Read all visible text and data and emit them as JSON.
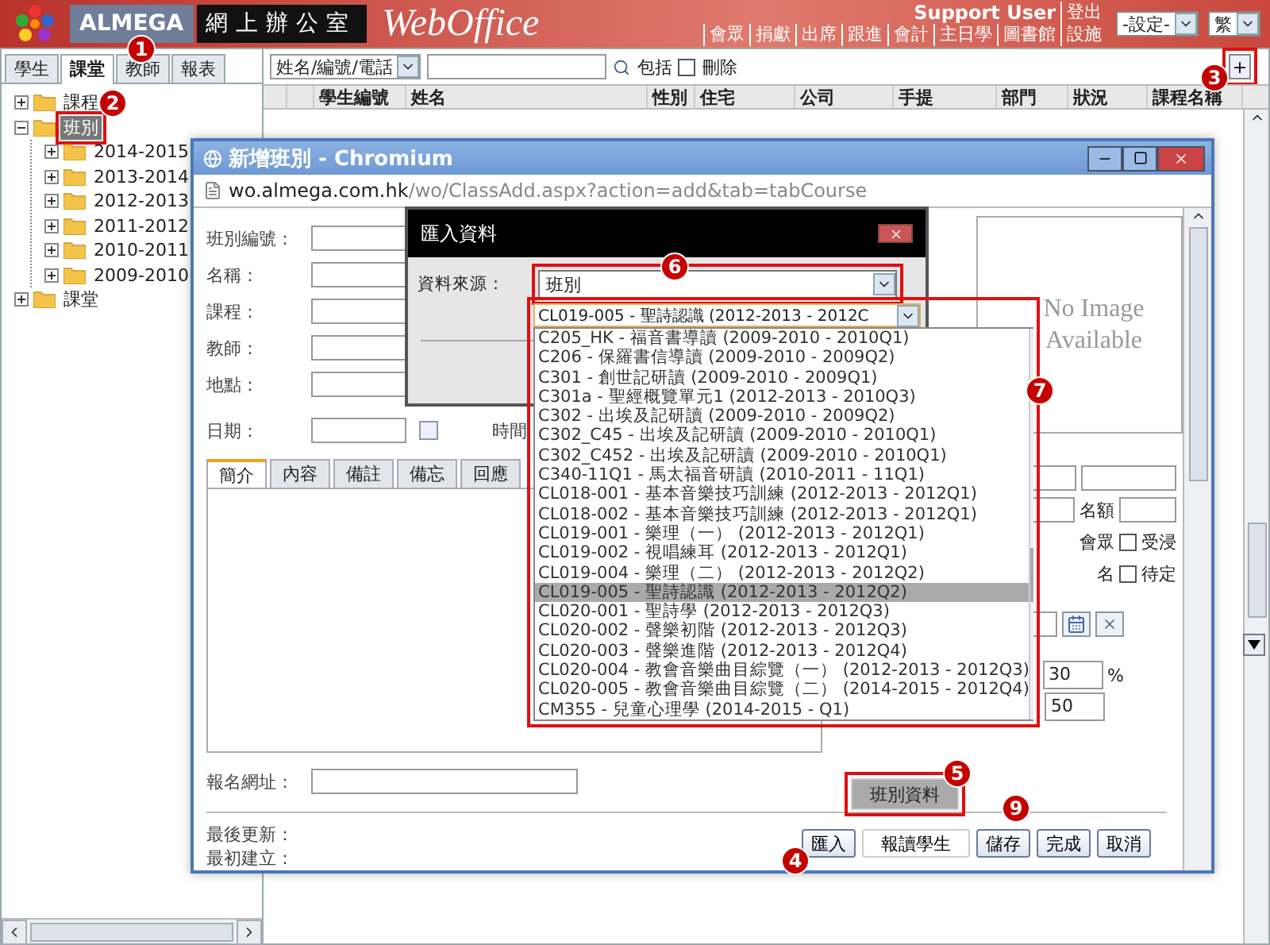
{
  "header": {
    "brand": "ALMEGA",
    "title": "網上辦公室",
    "product": "WebOffice",
    "user": "Support User",
    "logout": "登出",
    "nav": [
      "會眾",
      "捐獻",
      "出席",
      "跟進",
      "會計",
      "主日學",
      "圖書館",
      "設施"
    ],
    "settings_select": "-設定-",
    "language_select": "繁"
  },
  "left_panel": {
    "tabs": [
      {
        "label": "學生",
        "selected": false
      },
      {
        "label": "課堂",
        "selected": true
      },
      {
        "label": "教師",
        "selected": false
      },
      {
        "label": "報表",
        "selected": false
      }
    ],
    "tree": [
      {
        "label": "課程",
        "selected": false,
        "expanded": false
      },
      {
        "label": "班別",
        "selected": true,
        "expanded": true,
        "children": [
          {
            "label": "2014-2015",
            "selected": false,
            "expanded": false
          },
          {
            "label": "2013-2014",
            "selected": false,
            "expanded": false
          },
          {
            "label": "2012-2013",
            "selected": false,
            "expanded": false
          },
          {
            "label": "2011-2012",
            "selected": false,
            "expanded": false
          },
          {
            "label": "2010-2011",
            "selected": false,
            "expanded": false
          },
          {
            "label": "2009-2010",
            "selected": false,
            "expanded": false
          }
        ]
      },
      {
        "label": "課堂",
        "selected": false,
        "expanded": false
      }
    ]
  },
  "main": {
    "search_by": "姓名/編號/電話",
    "include_label": "包括",
    "delete_label": "刪除",
    "delete_checked": false,
    "add_button": "+",
    "columns": [
      "學生編號",
      "姓名",
      "性別",
      "住宅",
      "公司",
      "手提",
      "部門",
      "狀況",
      "課程名稱"
    ]
  },
  "popup": {
    "title": "新增班別 - Chromium",
    "url_host": "wo.almega.com.hk",
    "url_path": "/wo/ClassAdd.aspx?action=add&tab=tabCourse",
    "fields": [
      "班別編號：",
      "名稱：",
      "課程：",
      "教師：",
      "地點：",
      "日期："
    ],
    "time_label": "時間",
    "image_text": [
      "No Image",
      "Available"
    ],
    "quota_label": "名額",
    "checkboxes": [
      {
        "prefix": "會眾",
        "label": "受浸",
        "checked": false
      },
      {
        "prefix": "名",
        "label": "待定",
        "checked": false
      }
    ],
    "percent_value": "30",
    "percent_sign": "%",
    "second_value": "50",
    "tabs": [
      {
        "label": "簡介",
        "selected": true
      },
      {
        "label": "內容",
        "selected": false
      },
      {
        "label": "備註",
        "selected": false
      },
      {
        "label": "備忘",
        "selected": false
      },
      {
        "label": "回應",
        "selected": false
      }
    ],
    "url_label": "報名網址：",
    "meta": [
      "最後更新：",
      "最初建立："
    ],
    "buttons": [
      "匯入",
      "報讀學生",
      "儲存",
      "完成",
      "取消"
    ],
    "menu": [
      {
        "label": "班別資料",
        "selected": true
      }
    ]
  },
  "import_dialog": {
    "title": "匯入資料",
    "source_label": "資料來源：",
    "source_value": "班別"
  },
  "class_dropdown": {
    "value": "CL019-005 - 聖詩認識 (2012-2013 - 2012C",
    "options": [
      {
        "label": "C205_HK - 福音書導讀 (2009-2010 - 2010Q1)",
        "selected": false
      },
      {
        "label": "C206 - 保羅書信導讀 (2009-2010 - 2009Q2)",
        "selected": false
      },
      {
        "label": "C301 - 創世記研讀 (2009-2010 - 2009Q1)",
        "selected": false
      },
      {
        "label": "C301a - 聖經概覽單元1 (2012-2013 - 2010Q3)",
        "selected": false
      },
      {
        "label": "C302 - 出埃及記研讀 (2009-2010 - 2009Q2)",
        "selected": false
      },
      {
        "label": "C302_C45 - 出埃及記研讀 (2009-2010 - 2010Q1)",
        "selected": false
      },
      {
        "label": "C302_C452 - 出埃及記研讀 (2009-2010 - 2010Q1)",
        "selected": false
      },
      {
        "label": "C340-11Q1 - 馬太福音研讀 (2010-2011 - 11Q1)",
        "selected": false
      },
      {
        "label": "CL018-001 - 基本音樂技巧訓練 (2012-2013 - 2012Q1)",
        "selected": false
      },
      {
        "label": "CL018-002 - 基本音樂技巧訓練 (2012-2013 - 2012Q1)",
        "selected": false
      },
      {
        "label": "CL019-001 - 樂理（一） (2012-2013 - 2012Q1)",
        "selected": false
      },
      {
        "label": "CL019-002 - 視唱練耳 (2012-2013 - 2012Q1)",
        "selected": false
      },
      {
        "label": "CL019-004 - 樂理（二） (2012-2013 - 2012Q2)",
        "selected": false
      },
      {
        "label": "CL019-005 - 聖詩認識 (2012-2013 - 2012Q2)",
        "selected": true
      },
      {
        "label": "CL020-001 - 聖詩學 (2012-2013 - 2012Q3)",
        "selected": false
      },
      {
        "label": "CL020-002 - 聲樂初階 (2012-2013 - 2012Q3)",
        "selected": false
      },
      {
        "label": "CL020-003 - 聲樂進階 (2012-2013 - 2012Q4)",
        "selected": false
      },
      {
        "label": "CL020-004 - 教會音樂曲目綜覽（一） (2012-2013 - 2012Q3)",
        "selected": false
      },
      {
        "label": "CL020-005 - 教會音樂曲目綜覽（二） (2014-2015 - 2012Q4)",
        "selected": false
      },
      {
        "label": "CM355 - 兒童心理學 (2014-2015 - Q1)",
        "selected": false
      }
    ]
  },
  "annotations": [
    "1",
    "2",
    "3",
    "4",
    "5",
    "6",
    "7",
    "9"
  ]
}
